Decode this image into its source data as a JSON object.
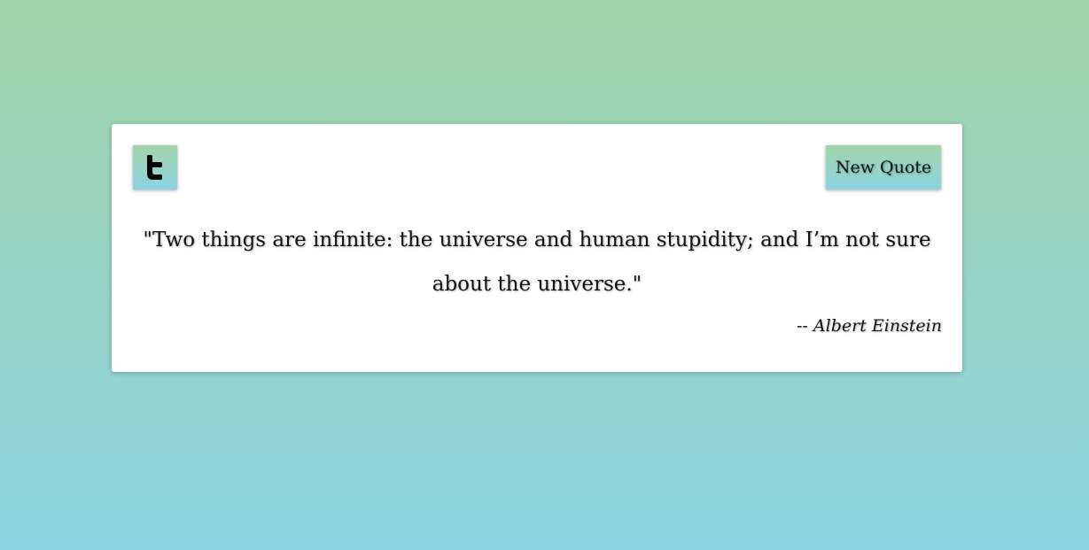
{
  "quote": {
    "text": "\"Two things are infinite: the universe and human stupidity; and I’m not sure about the universe.\"",
    "author_prefix": "-- ",
    "author": "Albert Einstein"
  },
  "buttons": {
    "tweet_icon": "twitter-icon",
    "new_quote_label": "New Quote"
  },
  "colors": {
    "gradient_top": "#a3d5aa",
    "gradient_bottom": "#8bd3e0",
    "card_background": "#ffffff",
    "text": "#111111"
  }
}
